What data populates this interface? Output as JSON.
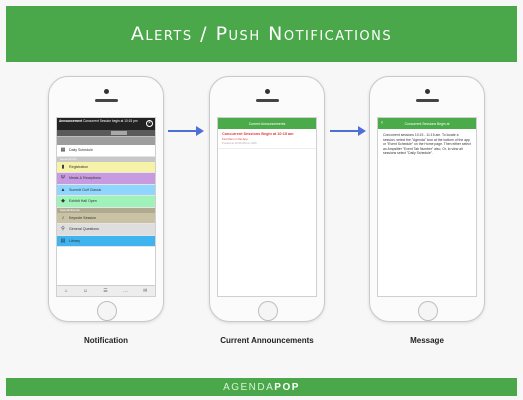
{
  "header": {
    "title": "Alerts / Push Notifications"
  },
  "footer": {
    "brand_prefix": "AGENDA",
    "brand_suffix": "POP"
  },
  "colors": {
    "green": "#4aa84a",
    "arrow": "#4d6fd8",
    "alert_red": "#e23636"
  },
  "captions": [
    "Notification",
    "Current Announcements",
    "Message"
  ],
  "screen1": {
    "banner_label": "Announcement",
    "banner_text": "Concurrent Session begin at 10:15 pm",
    "rows": [
      {
        "icon": "calendar-icon",
        "glyph": "▦",
        "label": "Daily Schedule",
        "bg": "#ffffff"
      },
      {
        "section": "General Info",
        "bg": "#c8c8c8"
      },
      {
        "icon": "info-icon",
        "glyph": "▮",
        "label": "Registration",
        "bg": "#f6f2a8"
      },
      {
        "icon": "fork-knife-icon",
        "glyph": "Ψ",
        "label": "Meals & Receptions",
        "bg": "#c89be0"
      },
      {
        "icon": "mountain-icon",
        "glyph": "▲",
        "label": "Summit Golf Classic",
        "bg": "#8fd6ff"
      },
      {
        "icon": "exhibit-icon",
        "glyph": "◆",
        "label": "Exhibit Hall Open",
        "bg": "#9ff2b8"
      },
      {
        "section": "Special Events",
        "bg": "#b0aa90"
      },
      {
        "icon": "speaker-icon",
        "glyph": "♪",
        "label": "Keynote Session",
        "bg": "#c9c2a5"
      },
      {
        "icon": "search-icon",
        "glyph": "⚲",
        "label": "General Questions",
        "bg": "#dedede"
      },
      {
        "icon": "library-icon",
        "glyph": "▤",
        "label": "Library",
        "bg": "#3fb4ef"
      }
    ],
    "bottom_icons": [
      "⌂",
      "☺",
      "☰",
      "…",
      "✉"
    ]
  },
  "screen2": {
    "bar_title": "Current Announcements",
    "items": [
      {
        "title": "Concurrent Sessions Begin at 10:15 am",
        "sub": "Find them in the App.",
        "date": "Posted at 10:00 AM on 4/20"
      }
    ]
  },
  "screen3": {
    "bar_title": "Concurrent Sessions Begin at",
    "back": "‹",
    "body": "Concurrent sessions 10:15 - 11:15 am. To locate a session, select the \"Agenda\" icon at the bottom of the app or \"Event Schedule\" on the Home page. Then either select an Ampsitter \"Event Tab Number\" also, Or, to view all sessions select \"Daily Schedule\"."
  }
}
